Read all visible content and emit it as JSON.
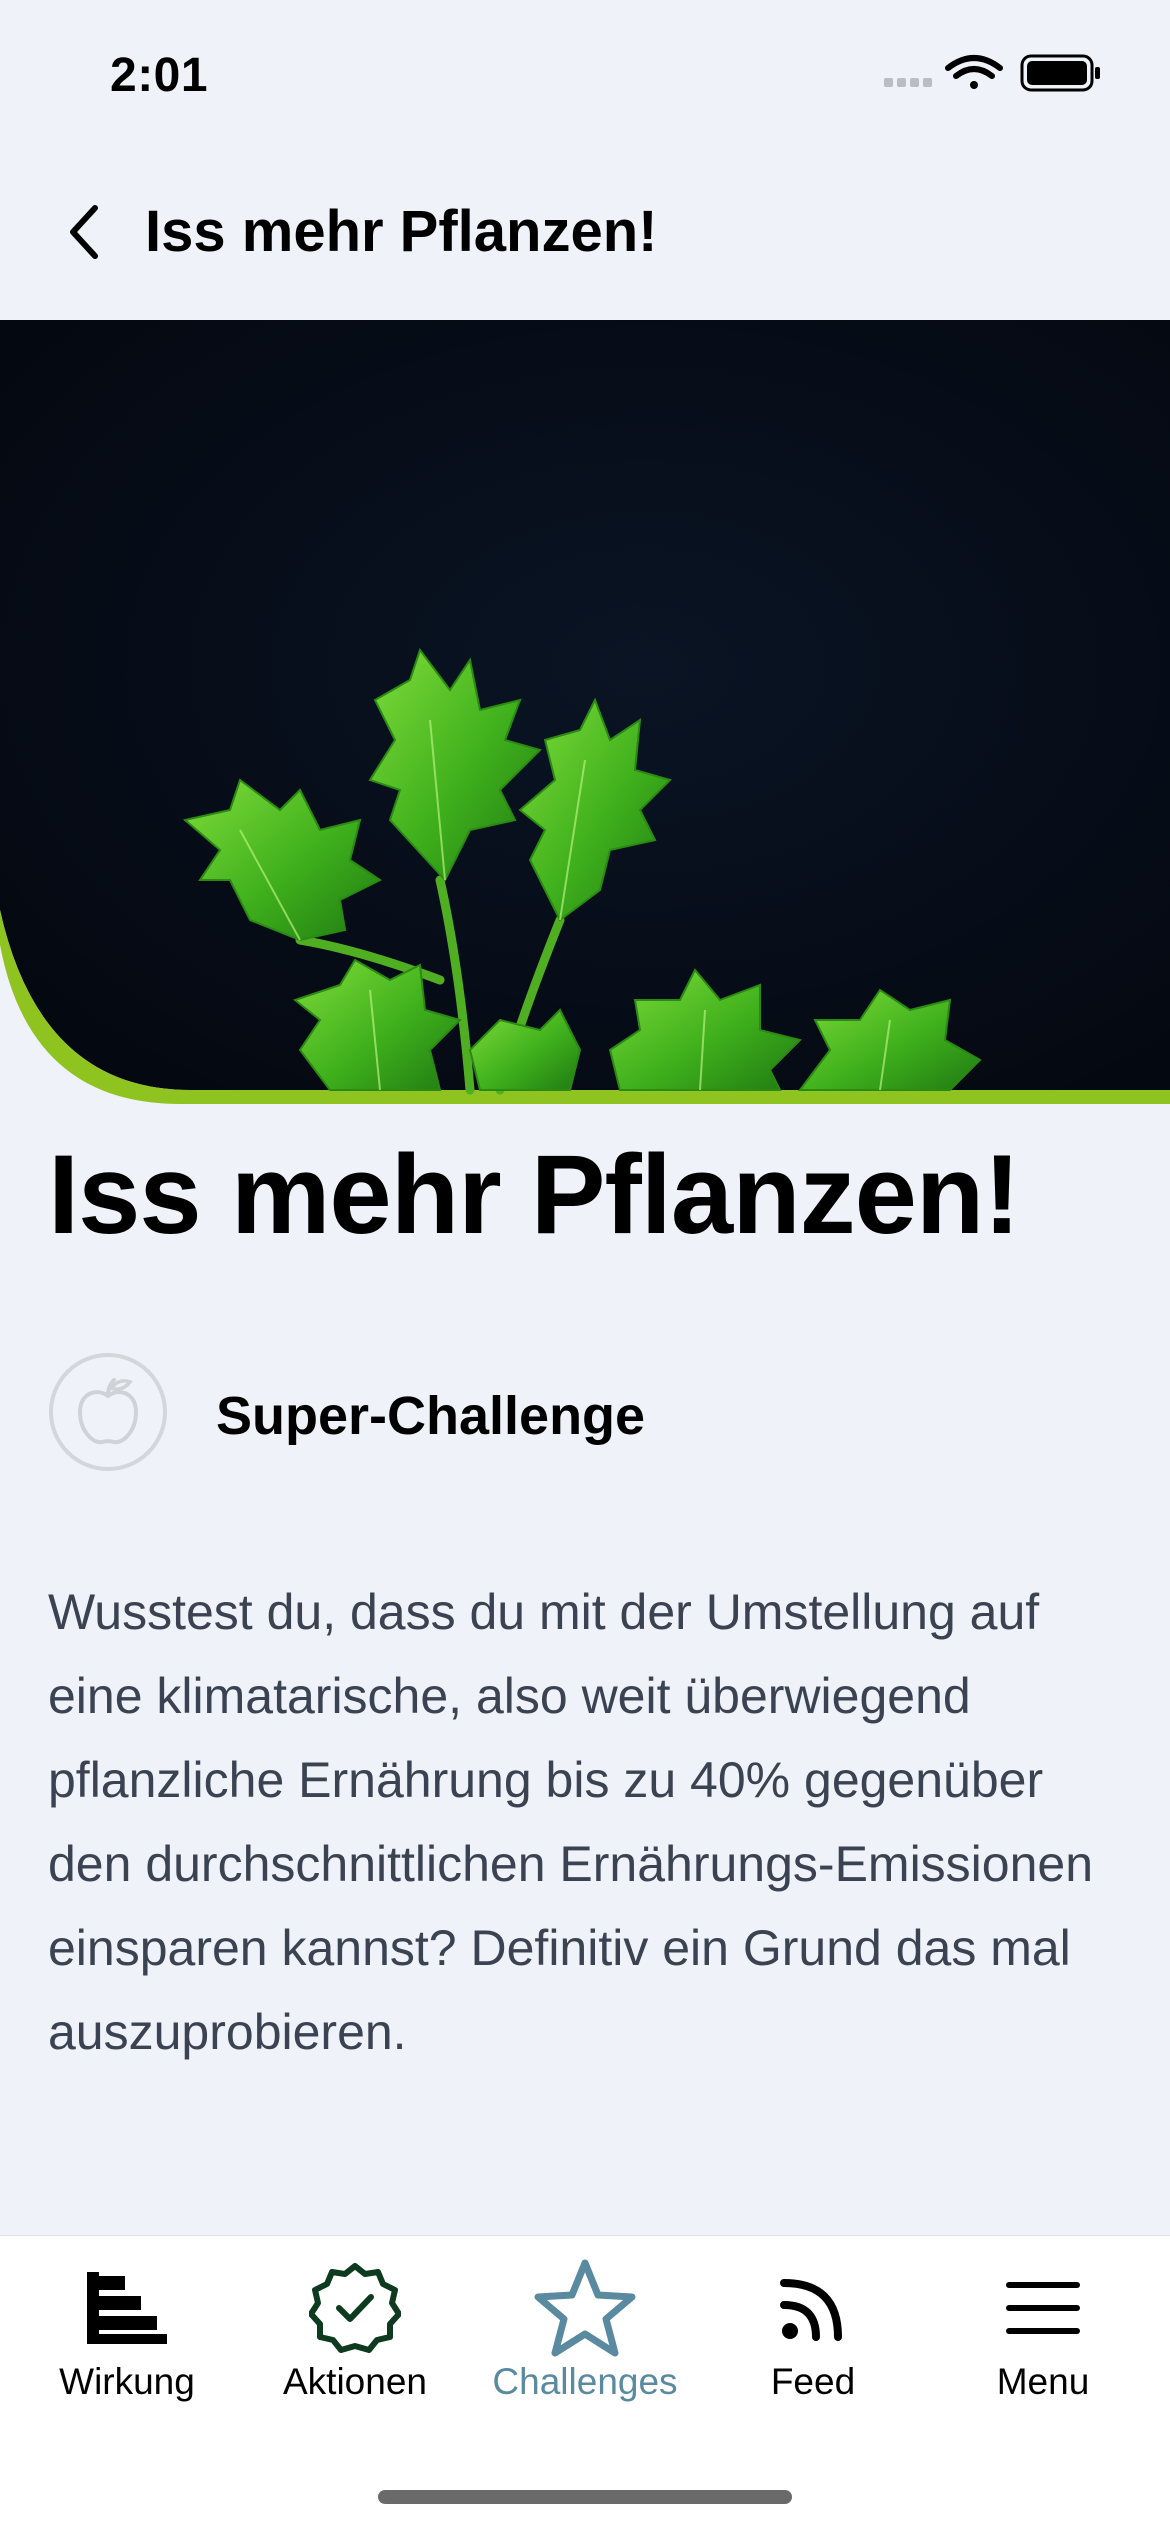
{
  "status_bar": {
    "time": "2:01",
    "icons": [
      "signal-icon",
      "wifi-icon",
      "battery-icon"
    ]
  },
  "nav": {
    "back_icon": "chevron-left-icon",
    "title": "Iss mehr Pflanzen!"
  },
  "hero": {
    "image": "green plant leaves on black background",
    "accent_color": "#8fc31f"
  },
  "challenge": {
    "title": "Iss mehr Pflanzen!",
    "badge_icon": "apple-icon",
    "badge_label": "Super-Challenge",
    "description": "Wusstest du, dass du mit der Umstellung auf eine klimatarische, also weit überwiegend pflanzliche Ernährung bis zu 40% gegenüber den durchschnittlichen Ernährungs-Emissionen einsparen kannst? Definitiv ein Grund das mal auszuprobieren."
  },
  "tabbar": {
    "active_color": "#5a8aa0",
    "tabs": [
      {
        "label": "Wirkung",
        "icon": "chart-bars-icon"
      },
      {
        "label": "Aktionen",
        "icon": "check-badge-icon"
      },
      {
        "label": "Challenges",
        "icon": "star-icon",
        "active": true
      },
      {
        "label": "Feed",
        "icon": "rss-feed-icon"
      },
      {
        "label": "Menu",
        "icon": "hamburger-menu-icon"
      }
    ]
  }
}
